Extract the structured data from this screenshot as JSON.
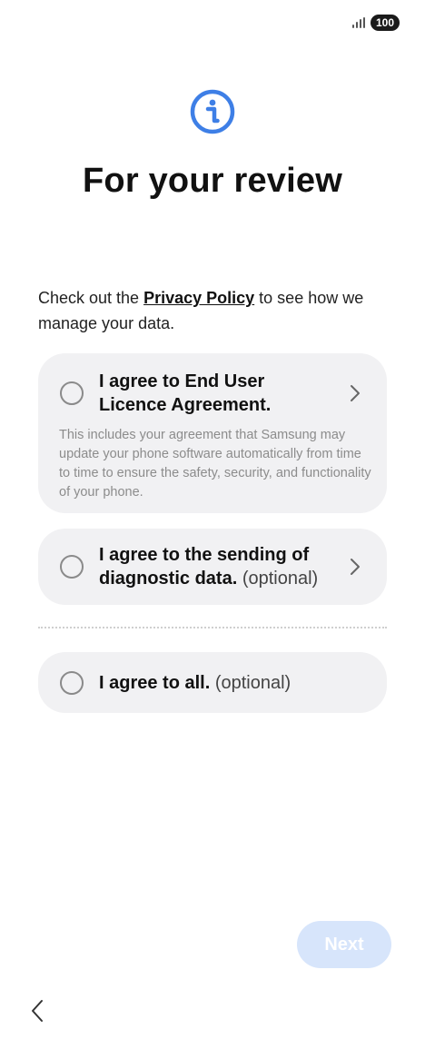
{
  "status": {
    "battery": "100",
    "signal_icon": "signal-icon"
  },
  "header": {
    "icon": "info-icon",
    "title": "For your review"
  },
  "policy": {
    "prefix": "Check out the ",
    "link": "Privacy Policy",
    "suffix": " to see how we manage your data."
  },
  "consents": [
    {
      "title": "I agree to End User Licence Agreement.",
      "description": "This includes your agreement that Samsung may update your phone software automatically from time to time to ensure the safety, security, and functionality of your phone."
    },
    {
      "title": "I agree to the sending of diagnostic data.",
      "optional": "(optional)"
    }
  ],
  "agree_all": {
    "title": "I agree to all.",
    "optional": "(optional)"
  },
  "footer": {
    "next_label": "Next"
  },
  "colors": {
    "accent": "#3e7fe6",
    "card": "#f1f1f3",
    "next_disabled": "#d7e5fb"
  }
}
